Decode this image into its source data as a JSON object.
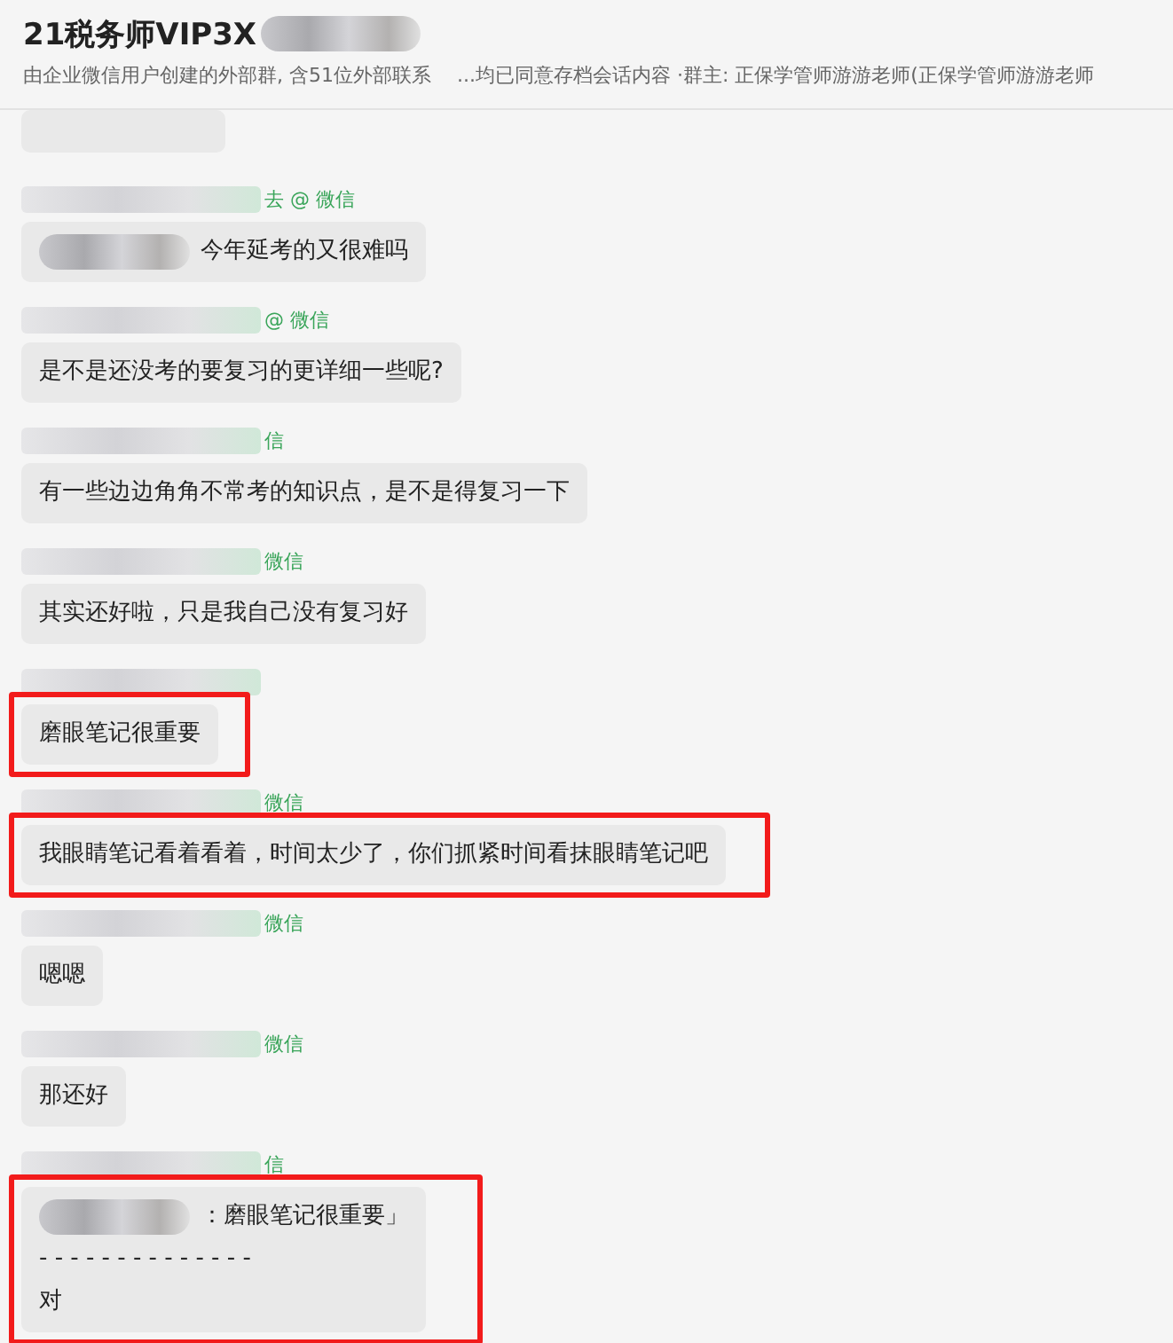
{
  "header": {
    "title": "21税务师VIP3X",
    "subtitle": "由企业微信用户创建的外部群, 含51位外部联系　 ...均已同意存档会话内容 ·群主: 正保学管师游游老师(正保学管师游游老师"
  },
  "messages": [
    {
      "kind": "partial"
    },
    {
      "kind": "text",
      "sender_suffix": "去 @ 微信",
      "quoted_name": true,
      "text": "今年延考的又很难吗",
      "highlighted": false
    },
    {
      "kind": "text",
      "sender_suffix": "@ 微信",
      "text": "是不是还没考的要复习的更详细一些呢?",
      "highlighted": false
    },
    {
      "kind": "text",
      "sender_suffix": "信",
      "text": "有一些边边角角不常考的知识点，是不是得复习一下",
      "highlighted": false
    },
    {
      "kind": "text",
      "sender_suffix": "微信",
      "text": "其实还好啦，只是我自己没有复习好",
      "highlighted": false
    },
    {
      "kind": "text",
      "text": "磨眼笔记很重要",
      "highlighted": true
    },
    {
      "kind": "text",
      "sender_suffix": "微信",
      "text": "我眼睛笔记看着看着，时间太少了，你们抓紧时间看抹眼睛笔记吧",
      "highlighted": true
    },
    {
      "kind": "text",
      "sender_suffix": "微信",
      "text": "嗯嗯",
      "highlighted": false
    },
    {
      "kind": "text",
      "sender_suffix": "微信",
      "text": "那还好",
      "highlighted": false
    },
    {
      "kind": "quote",
      "sender_suffix": "信",
      "quote": "：磨眼笔记很重要」",
      "divider": "- - - - - - - - - - - - - -",
      "text": "对",
      "highlighted": true
    }
  ]
}
